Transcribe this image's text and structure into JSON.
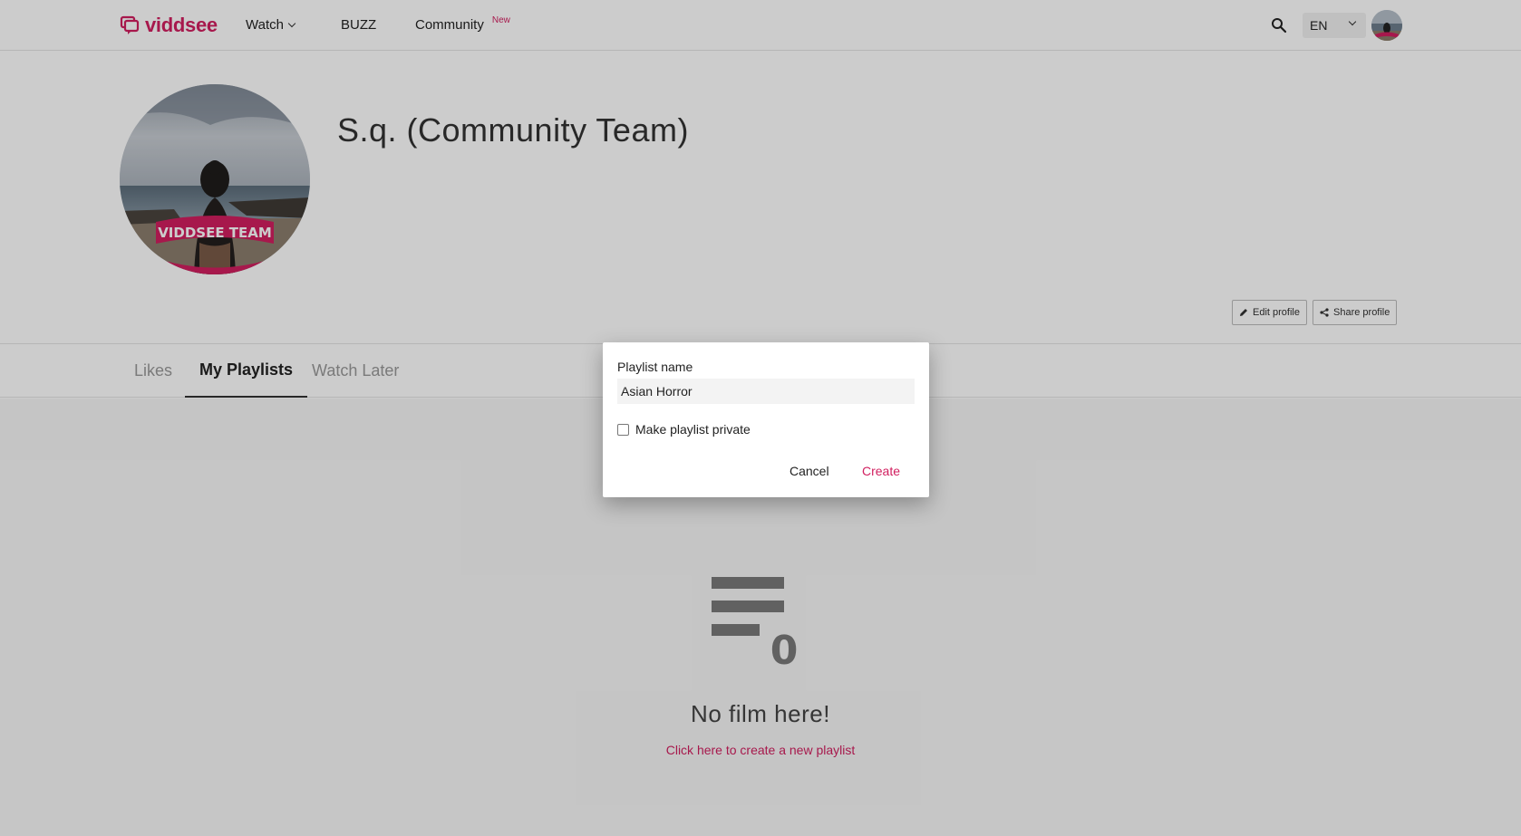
{
  "brand": {
    "name": "viddsee",
    "accent": "#d11f5f"
  },
  "nav": {
    "watch": "Watch",
    "buzz": "BUZZ",
    "community": "Community",
    "community_badge": "New",
    "search_icon": "search-icon",
    "language": "EN"
  },
  "profile": {
    "name": "S.q. (Community Team)",
    "avatar_banner": "VIDDSEE TEAM",
    "edit_button": "Edit profile",
    "share_button": "Share profile"
  },
  "tabs": [
    {
      "label": "Likes",
      "active": false
    },
    {
      "label": "My Playlists",
      "active": true
    },
    {
      "label": "Watch Later",
      "active": false
    }
  ],
  "empty_state": {
    "count": "0",
    "title": "No film here!",
    "link": "Click here to create a new playlist"
  },
  "dialog": {
    "field_label": "Playlist name",
    "field_value": "Asian Horror",
    "private_label": "Make playlist private",
    "private_checked": false,
    "cancel": "Cancel",
    "create": "Create"
  }
}
